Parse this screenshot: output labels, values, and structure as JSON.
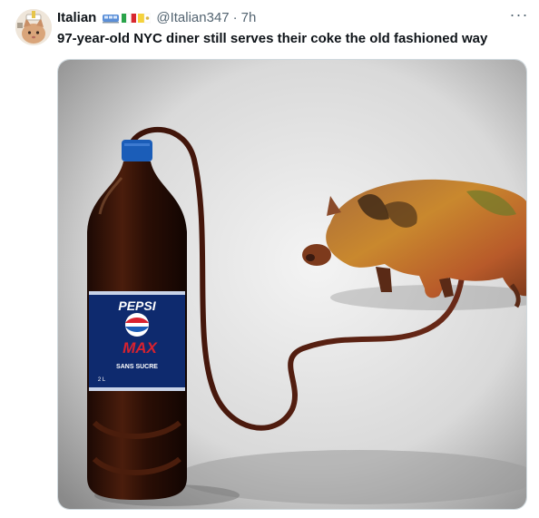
{
  "tweet": {
    "author_name": "Italian",
    "handle": "@Italian347",
    "separator": "·",
    "time": "7h",
    "text": "97-year-old NYC diner still serves their coke the old fashioned way",
    "more_label": "···",
    "flag_icons": [
      "train-icon",
      "italy-flag-icon",
      "vatican-flag-icon"
    ],
    "avatar_icon": "cat-wearing-hat-avatar"
  },
  "media": {
    "bottle_label_brand": "PEPSI",
    "bottle_label_product": "MAX",
    "bottle_label_line1": "SANS SUCRE",
    "bottle_label_line2": "2 L",
    "icons": [
      "soda-bottle-icon",
      "tube-icon",
      "pig-icon"
    ]
  }
}
